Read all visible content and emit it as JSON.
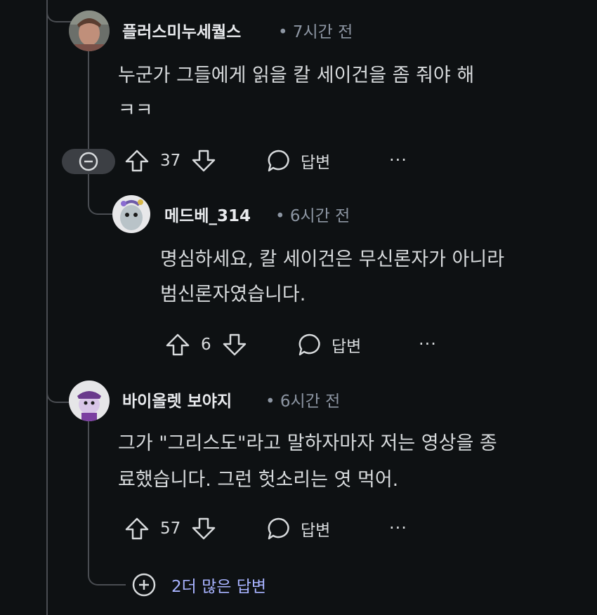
{
  "comments": [
    {
      "username": "플러스미누세퀄스",
      "time": "• 7시간 전",
      "lines": [
        "누군가 그들에게 읽을 칼 세이건을 좀 줘야 해",
        "ㅋㅋ"
      ],
      "votes": "37",
      "reply_label": "답변"
    },
    {
      "username": "메드베_314",
      "time": "• 6시간 전",
      "lines": [
        "명심하세요, 칼 세이건은 무신론자가 아니라",
        "범신론자였습니다."
      ],
      "votes": "6",
      "reply_label": "답변"
    },
    {
      "username": "바이올렛 보야지",
      "time": "• 6시간 전",
      "lines": [
        "그가 \"그리스도\"라고 말하자마자 저는 영상을 종",
        "료했습니다. 그런 헛소리는 엿 먹어."
      ],
      "votes": "57",
      "reply_label": "답변"
    }
  ],
  "more_replies": "2더 많은 답변",
  "more_glyph": "···",
  "colors": {
    "background": "#0e1113",
    "thread_line": "#4a4d52",
    "link": "#a8b3ff",
    "meta": "#8d96a3"
  }
}
